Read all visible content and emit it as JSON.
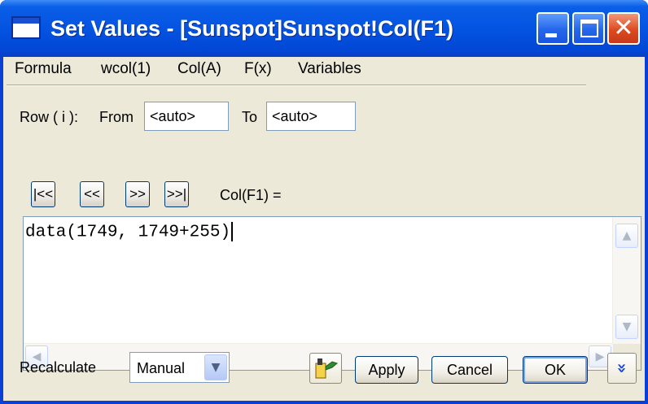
{
  "window": {
    "title": "Set Values - [Sunspot]Sunspot!Col(F1)"
  },
  "menu": {
    "items": [
      "Formula",
      "wcol(1)",
      "Col(A)",
      "F(x)",
      "Variables"
    ]
  },
  "row_range": {
    "label": "Row ( i ):",
    "from_label": "From",
    "from_value": "<auto>",
    "to_label": "To",
    "to_value": "<auto>"
  },
  "navigation": {
    "first": "|<<",
    "prev": "<<",
    "next": ">>",
    "last": ">>|",
    "column_label": "Col(F1) ="
  },
  "formula": {
    "text": "data(1749, 1749+255)"
  },
  "recalculate": {
    "label": "Recalculate",
    "selected": "Manual"
  },
  "buttons": {
    "apply": "Apply",
    "cancel": "Cancel",
    "ok": "OK"
  },
  "icons": {
    "window_icon": "window-icon",
    "minimize": "minimize-icon",
    "maximize": "maximize-icon",
    "close": "close-icon",
    "formula_tool": "pointing-hand-icon",
    "expand": "double-chevron-down-icon"
  },
  "colors": {
    "titlebar": "#0454e2",
    "dialog_bg": "#ece9d8",
    "close_button": "#de4b21"
  }
}
